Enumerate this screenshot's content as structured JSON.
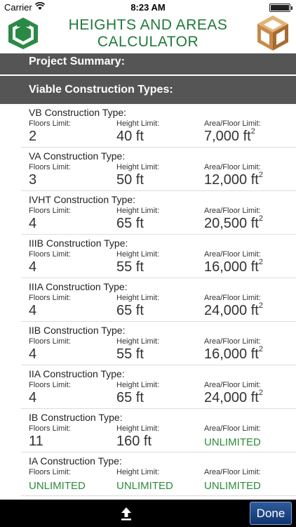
{
  "status_bar": {
    "carrier": "Carrier",
    "time": "8:23 AM"
  },
  "app": {
    "title_line1": "HEIGHTS AND AREAS",
    "title_line2": "CALCULATOR"
  },
  "sections": {
    "summary": "Project Summary:",
    "viable": "Viable Construction Types:"
  },
  "labels": {
    "floors": "Floors Limit:",
    "height": "Height Limit:",
    "area": "Area/Floor Limit:"
  },
  "rows": [
    {
      "type": "VB Construction Type:",
      "floors": "2",
      "height": "40 ft",
      "area": "7,000 ft",
      "area_sup": "2"
    },
    {
      "type": "VA Construction Type:",
      "floors": "3",
      "height": "50 ft",
      "area": "12,000 ft",
      "area_sup": "2"
    },
    {
      "type": "IVHT Construction Type:",
      "floors": "4",
      "height": "65 ft",
      "area": "20,500 ft",
      "area_sup": "2"
    },
    {
      "type": "IIIB Construction Type:",
      "floors": "4",
      "height": "55 ft",
      "area": "16,000 ft",
      "area_sup": "2"
    },
    {
      "type": "IIIA Construction Type:",
      "floors": "4",
      "height": "65 ft",
      "area": "24,000 ft",
      "area_sup": "2"
    },
    {
      "type": "IIB Construction Type:",
      "floors": "4",
      "height": "55 ft",
      "area": "16,000 ft",
      "area_sup": "2"
    },
    {
      "type": "IIA Construction Type:",
      "floors": "4",
      "height": "65 ft",
      "area": "24,000 ft",
      "area_sup": "2"
    },
    {
      "type": "IB Construction Type:",
      "floors": "11",
      "height": "160 ft",
      "area": "UNLIMITED",
      "area_sup": ""
    },
    {
      "type": "IA Construction Type:",
      "floors": "UNLIMITED",
      "height": "UNLIMITED",
      "area": "UNLIMITED",
      "area_sup": ""
    }
  ],
  "toolbar": {
    "done_label": "Done",
    "upload_icon": "share-upload-icon"
  },
  "colors": {
    "title_green": "#1f7a3a",
    "unlimited_green": "#2e8b3a",
    "section_gray": "#555555",
    "done_blue": "#1f4a8a"
  }
}
